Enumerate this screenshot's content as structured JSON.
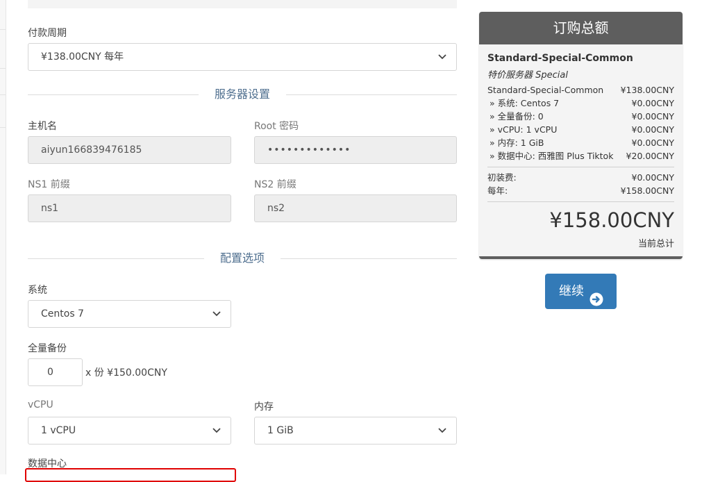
{
  "billing": {
    "label": "付款周期",
    "selected": "¥138.00CNY 每年"
  },
  "server_section": {
    "title": "服务器设置",
    "hostname_label": "主机名",
    "hostname_value": "aiyun166839476185",
    "root_label": "Root 密码",
    "root_value": "•••••••••••••",
    "ns1_label": "NS1 前缀",
    "ns1_value": "ns1",
    "ns2_label": "NS2 前缀",
    "ns2_value": "ns2"
  },
  "config_section": {
    "title": "配置选项",
    "os_label": "系统",
    "os_selected": "Centos 7",
    "backup_label": "全量备份",
    "backup_value": "0",
    "backup_suffix": "x 份 ¥150.00CNY",
    "vcpu_label": "vCPU",
    "vcpu_selected": "1 vCPU",
    "memory_label": "内存",
    "memory_selected": "1 GiB",
    "datacenter_label": "数据中心"
  },
  "summary": {
    "title": "订购总额",
    "product_name": "Standard-Special-Common",
    "product_group": "特价服务器 Special",
    "base_line": {
      "label": "Standard-Special-Common",
      "price": "¥138.00CNY"
    },
    "options": [
      {
        "label": "» 系统: Centos 7",
        "price": "¥0.00CNY"
      },
      {
        "label": "» 全量备份: 0",
        "price": "¥0.00CNY"
      },
      {
        "label": "» vCPU: 1 vCPU",
        "price": "¥0.00CNY"
      },
      {
        "label": "» 内存: 1 GiB",
        "price": "¥0.00CNY"
      },
      {
        "label": "» 数据中心: 西雅图 Plus Tiktok",
        "price": "¥20.00CNY"
      }
    ],
    "setup_fee": {
      "label": "初装费:",
      "price": "¥0.00CNY"
    },
    "recurring": {
      "label": "每年:",
      "price": "¥158.00CNY"
    },
    "total": "¥158.00CNY",
    "total_label": "当前总计"
  },
  "continue_button": {
    "label": "继续",
    "icon": "arrow-circle-right-icon"
  },
  "colors": {
    "accent_button": "#337ab7",
    "summary_header": "#5e5e5e",
    "section_title": "#4f6f8f",
    "highlight_border": "#e00000"
  }
}
